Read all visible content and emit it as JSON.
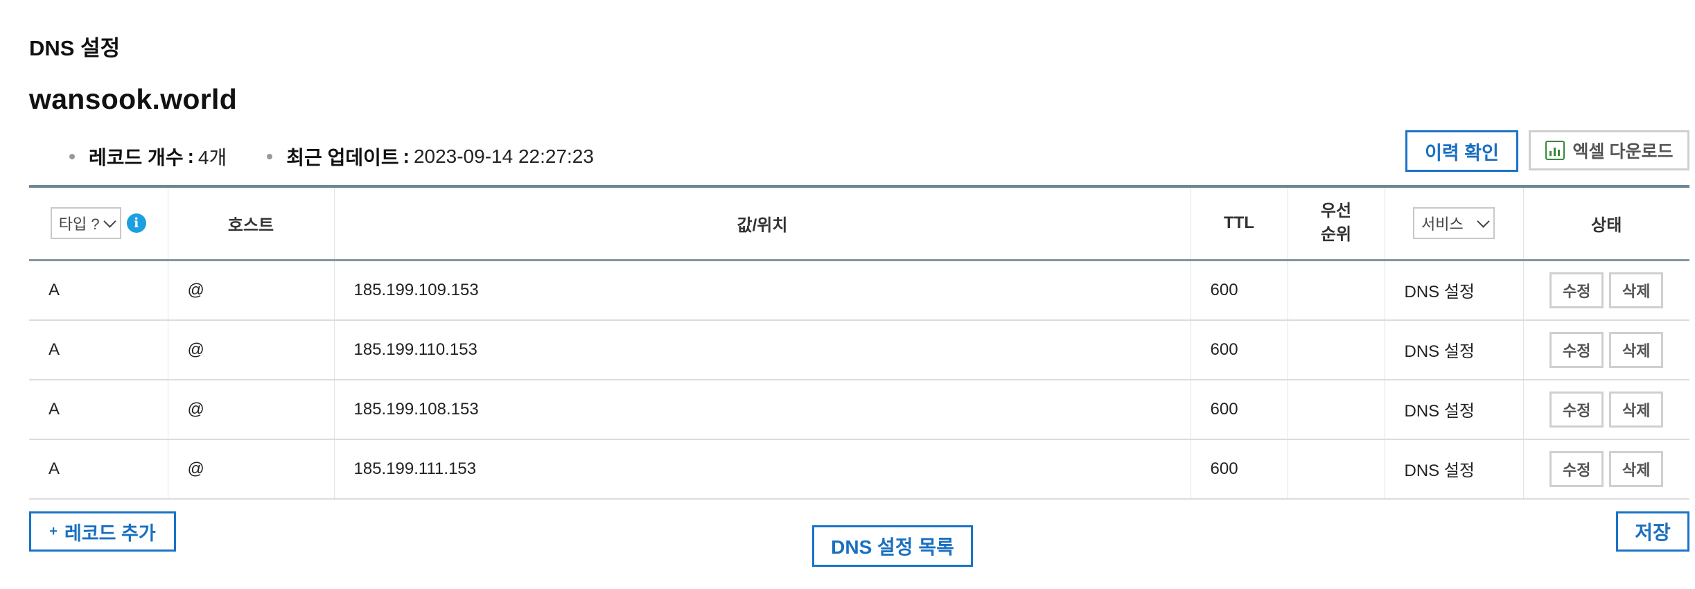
{
  "page": {
    "section_title": "DNS 설정",
    "domain": "wansook.world"
  },
  "meta": {
    "record_count_label": "레코드 개수",
    "record_count_value": "4개",
    "updated_label": "최근 업데이트",
    "updated_value": "2023-09-14 22:27:23",
    "separator": ":"
  },
  "toolbar": {
    "history_label": "이력 확인",
    "excel_label": "엑셀 다운로드",
    "excel_icon": "bar-chart-icon"
  },
  "table": {
    "headers": {
      "type_select": "타입 ?",
      "host": "호스트",
      "value": "값/위치",
      "ttl": "TTL",
      "priority_line1": "우선",
      "priority_line2": "순위",
      "service_select": "서비스",
      "status": "상태"
    },
    "rows": [
      {
        "type": "A",
        "host": "@",
        "value": "185.199.109.153",
        "ttl": "600",
        "priority": "",
        "service": "DNS 설정",
        "edit": "수정",
        "delete": "삭제"
      },
      {
        "type": "A",
        "host": "@",
        "value": "185.199.110.153",
        "ttl": "600",
        "priority": "",
        "service": "DNS 설정",
        "edit": "수정",
        "delete": "삭제"
      },
      {
        "type": "A",
        "host": "@",
        "value": "185.199.108.153",
        "ttl": "600",
        "priority": "",
        "service": "DNS 설정",
        "edit": "수정",
        "delete": "삭제"
      },
      {
        "type": "A",
        "host": "@",
        "value": "185.199.111.153",
        "ttl": "600",
        "priority": "",
        "service": "DNS 설정",
        "edit": "수정",
        "delete": "삭제"
      }
    ]
  },
  "footer": {
    "add_plus": "+",
    "add_label": "레코드 추가",
    "list_label": "DNS 설정 목록",
    "save_label": "저장"
  },
  "colors": {
    "accent_blue": "#1a73c8",
    "info_icon": "#1aa0e0",
    "excel_green": "#3a8a3a",
    "table_header_border": "#6e8795"
  }
}
